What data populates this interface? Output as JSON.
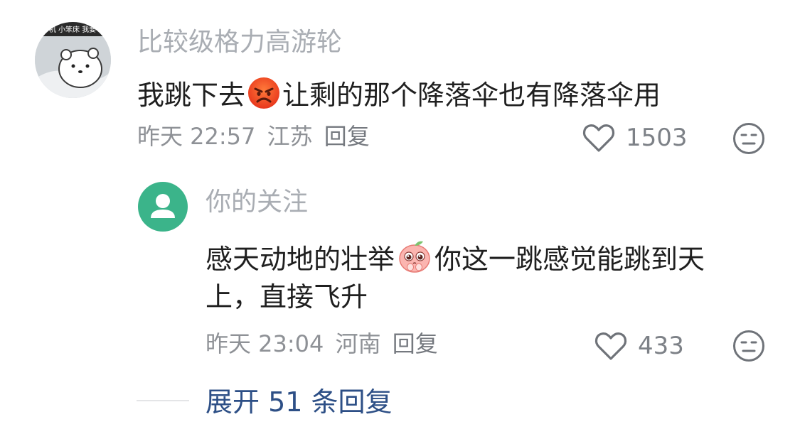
{
  "comment": {
    "username": "比较级格力高游轮",
    "avatar_text": "机 小笨床 我要",
    "text_before_emoji": "我跳下去",
    "emoji": "angry-face-emoji",
    "text_after_emoji": "让剩的那个降落伞也有降落伞用",
    "time": "昨天 22:57",
    "location": "江苏",
    "reply_label": "回复",
    "like_icon": "heart-outline-icon",
    "likes": "1503",
    "dislike_icon": "neutral-face-icon"
  },
  "reply": {
    "username": "你的关注",
    "avatar_icon": "person-icon",
    "line1_before_emoji": "感天动地的壮举",
    "emoji": "pleading-peach-emoji",
    "line1_after_emoji": "你这一跳感觉能跳到天",
    "line2": "上，直接飞升",
    "time": "昨天 23:04",
    "location": "河南",
    "reply_label": "回复",
    "like_icon": "heart-outline-icon",
    "likes": "433",
    "dislike_icon": "neutral-face-icon"
  },
  "expand": {
    "label": "展开 51 条回复"
  },
  "colors": {
    "username": "#a9adb3",
    "meta": "#8e9196",
    "expand_link": "#2d4f86",
    "reply_avatar": "#3bb48a"
  }
}
